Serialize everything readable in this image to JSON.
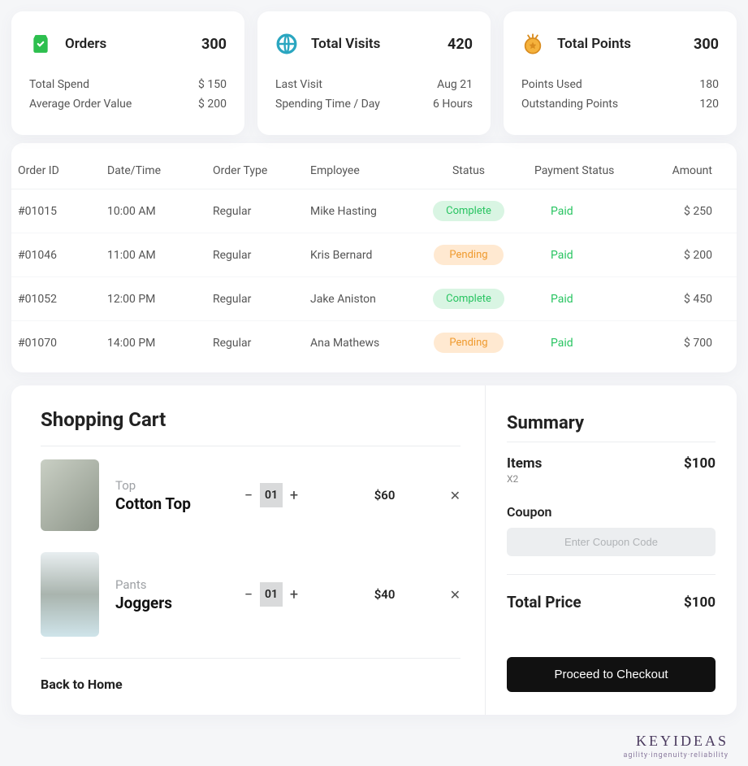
{
  "cards": {
    "orders": {
      "title": "Orders",
      "value": "300",
      "rows": [
        {
          "label": "Total Spend",
          "value": "$ 150"
        },
        {
          "label": "Average Order Value",
          "value": "$ 200"
        }
      ]
    },
    "visits": {
      "title": "Total Visits",
      "value": "420",
      "rows": [
        {
          "label": "Last Visit",
          "value": "Aug 21"
        },
        {
          "label": "Spending Time / Day",
          "value": "6 Hours"
        }
      ]
    },
    "points": {
      "title": "Total Points",
      "value": "300",
      "rows": [
        {
          "label": "Points Used",
          "value": "180"
        },
        {
          "label": "Outstanding Points",
          "value": "120"
        }
      ]
    }
  },
  "table": {
    "headers": [
      "Order ID",
      "Date/Time",
      "Order Type",
      "Employee",
      "Status",
      "Payment Status",
      "Amount"
    ],
    "rows": [
      {
        "id": "#01015",
        "time": "10:00 AM",
        "type": "Regular",
        "emp": "Mike Hasting",
        "status": "Complete",
        "status_kind": "complete",
        "pay": "Paid",
        "amount": "$ 250"
      },
      {
        "id": "#01046",
        "time": "11:00 AM",
        "type": "Regular",
        "emp": "Kris Bernard",
        "status": "Pending",
        "status_kind": "pending",
        "pay": "Paid",
        "amount": "$ 200"
      },
      {
        "id": "#01052",
        "time": "12:00 PM",
        "type": "Regular",
        "emp": "Jake Aniston",
        "status": "Complete",
        "status_kind": "complete",
        "pay": "Paid",
        "amount": "$ 450"
      },
      {
        "id": "#01070",
        "time": "14:00 PM",
        "type": "Regular",
        "emp": "Ana Mathews",
        "status": "Pending",
        "status_kind": "pending",
        "pay": "Paid",
        "amount": "$ 700"
      }
    ]
  },
  "cart": {
    "title": "Shopping Cart",
    "items": [
      {
        "category": "Top",
        "name": "Cotton Top",
        "qty": "01",
        "price": "$60"
      },
      {
        "category": "Pants",
        "name": "Joggers",
        "qty": "01",
        "price": "$40"
      }
    ],
    "back_label": "Back to Home"
  },
  "summary": {
    "title": "Summary",
    "items_label": "Items",
    "items_sub": "X2",
    "items_total": "$100",
    "coupon_label": "Coupon",
    "coupon_placeholder": "Enter Coupon Code",
    "total_label": "Total Price",
    "total_value": "$100",
    "checkout_label": "Proceed to Checkout"
  },
  "footer": {
    "brand": "KEYIDEAS",
    "tagline": "agility·ingenuity·reliability"
  }
}
